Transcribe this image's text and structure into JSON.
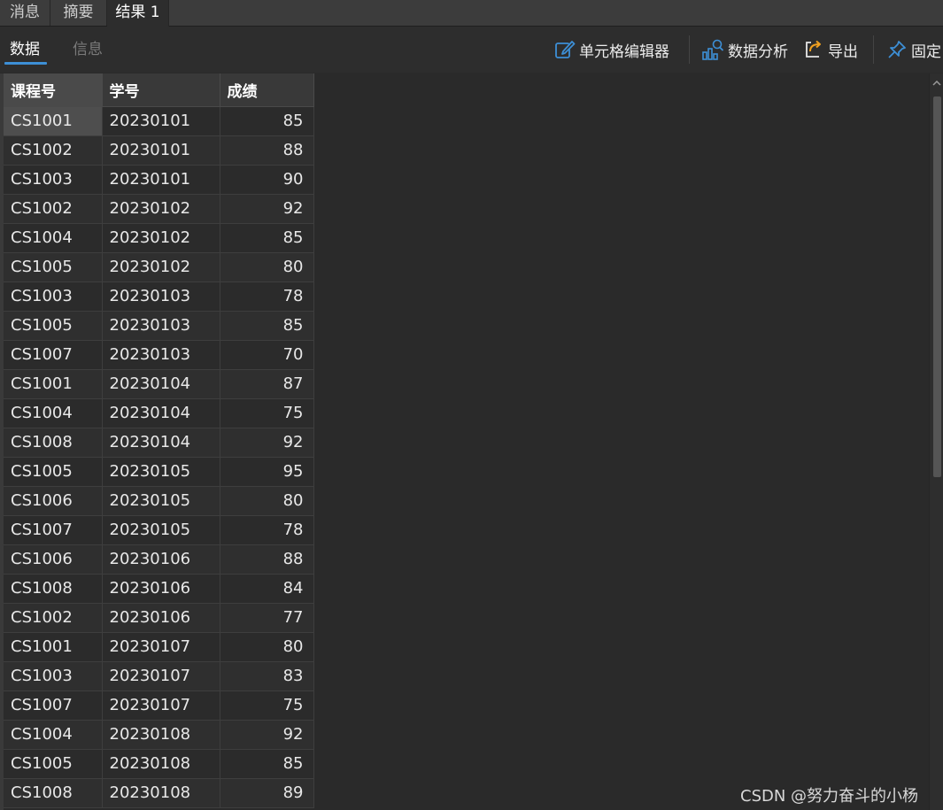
{
  "tabs": [
    {
      "label": "消息"
    },
    {
      "label": "摘要"
    },
    {
      "label": "结果 1"
    }
  ],
  "subtabs": [
    {
      "label": "数据"
    },
    {
      "label": "信息"
    }
  ],
  "toolbar": {
    "cell_editor": "单元格编辑器",
    "data_analysis": "数据分析",
    "export": "导出",
    "pin": "固定"
  },
  "colors": {
    "accent": "#3d8fd6",
    "export_icon": "#f0a020"
  },
  "grid": {
    "columns": [
      "课程号",
      "学号",
      "成绩"
    ],
    "rows": [
      [
        "CS1001",
        "20230101",
        "85"
      ],
      [
        "CS1002",
        "20230101",
        "88"
      ],
      [
        "CS1003",
        "20230101",
        "90"
      ],
      [
        "CS1002",
        "20230102",
        "92"
      ],
      [
        "CS1004",
        "20230102",
        "85"
      ],
      [
        "CS1005",
        "20230102",
        "80"
      ],
      [
        "CS1003",
        "20230103",
        "78"
      ],
      [
        "CS1005",
        "20230103",
        "85"
      ],
      [
        "CS1007",
        "20230103",
        "70"
      ],
      [
        "CS1001",
        "20230104",
        "87"
      ],
      [
        "CS1004",
        "20230104",
        "75"
      ],
      [
        "CS1008",
        "20230104",
        "92"
      ],
      [
        "CS1005",
        "20230105",
        "95"
      ],
      [
        "CS1006",
        "20230105",
        "80"
      ],
      [
        "CS1007",
        "20230105",
        "78"
      ],
      [
        "CS1006",
        "20230106",
        "88"
      ],
      [
        "CS1008",
        "20230106",
        "84"
      ],
      [
        "CS1002",
        "20230106",
        "77"
      ],
      [
        "CS1001",
        "20230107",
        "80"
      ],
      [
        "CS1003",
        "20230107",
        "83"
      ],
      [
        "CS1007",
        "20230107",
        "75"
      ],
      [
        "CS1004",
        "20230108",
        "92"
      ],
      [
        "CS1005",
        "20230108",
        "85"
      ],
      [
        "CS1008",
        "20230108",
        "89"
      ]
    ]
  },
  "watermark": "CSDN @努力奋斗的小杨"
}
